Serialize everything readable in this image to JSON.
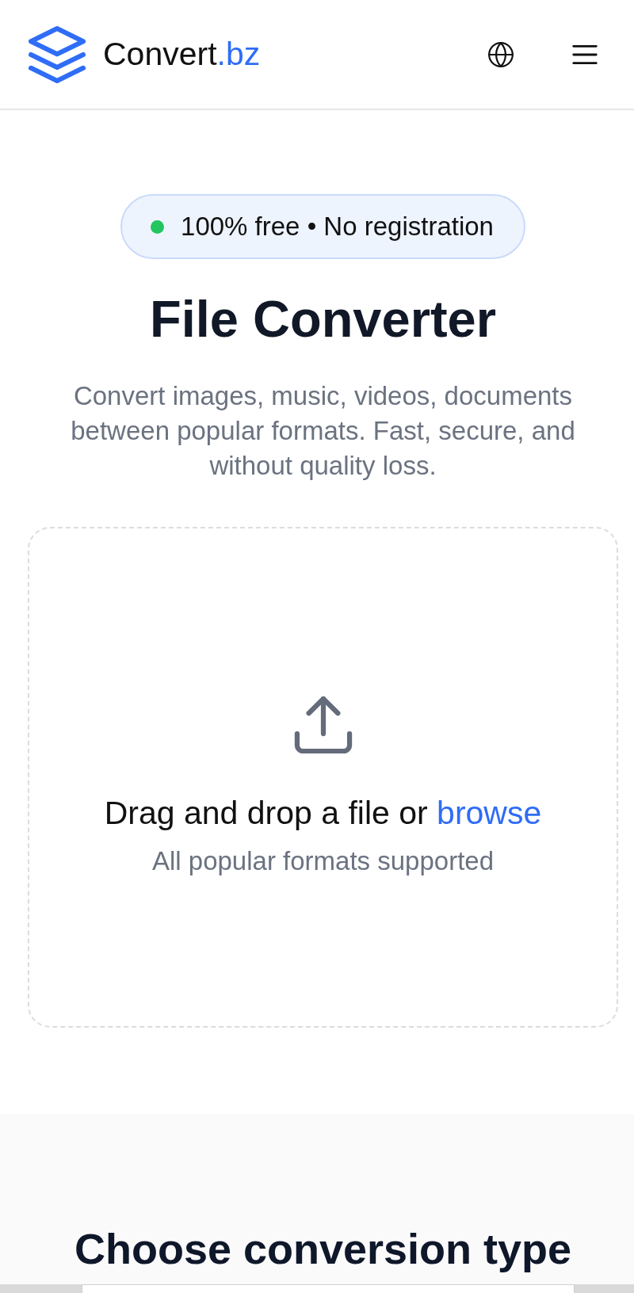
{
  "header": {
    "logo": {
      "name": "Convert",
      "accent": ".bz"
    }
  },
  "hero": {
    "badge": "100% free • No registration",
    "title": "File Converter",
    "subtitle": "Convert images, music, videos, documents between popular formats. Fast, secure, and without quality loss."
  },
  "dropzone": {
    "prompt": "Drag and drop a file or",
    "link": "browse",
    "hint": "All popular formats supported"
  },
  "section": {
    "title": "Choose conversion type"
  }
}
